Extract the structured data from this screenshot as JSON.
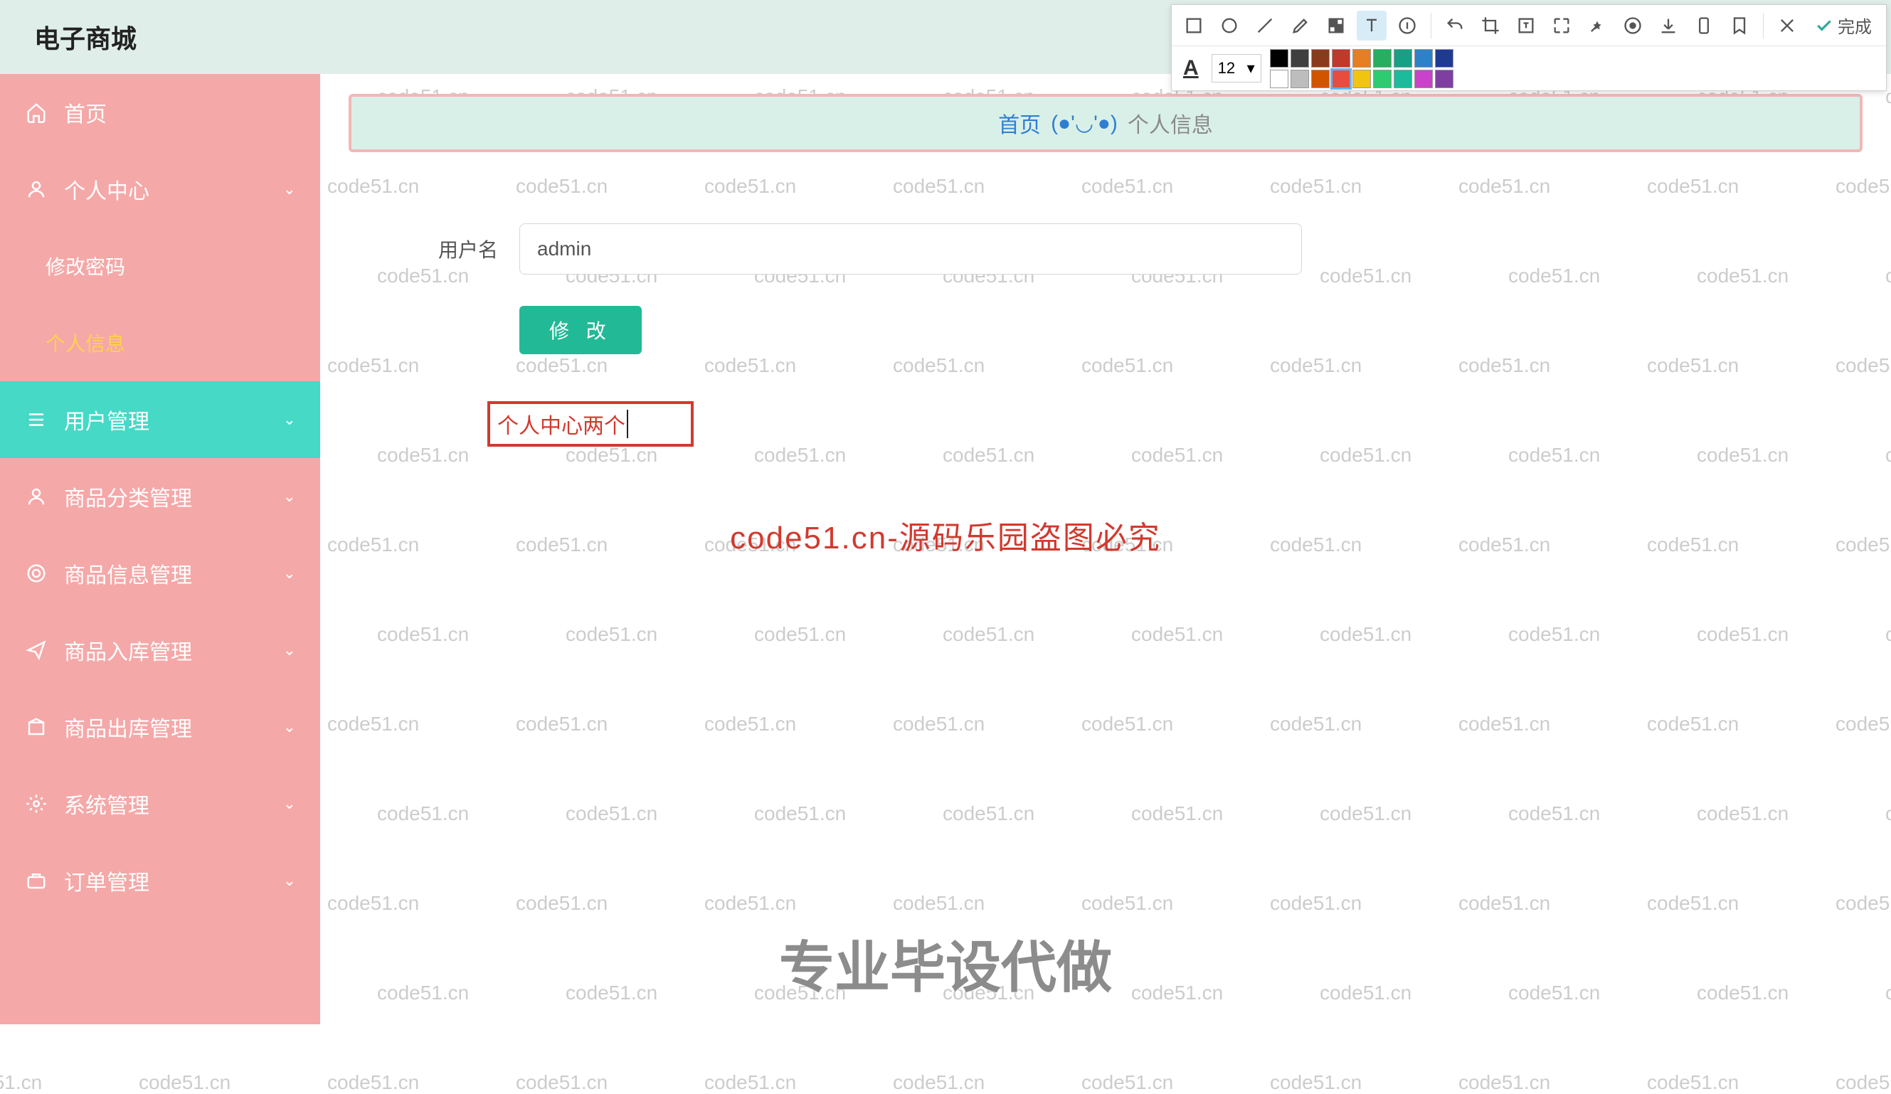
{
  "brand": "电子商城",
  "sidebar": {
    "items": [
      {
        "label": "首页",
        "icon": "home"
      },
      {
        "label": "个人中心",
        "icon": "user",
        "expandable": true
      },
      {
        "label": "修改密码",
        "sub": true
      },
      {
        "label": "个人信息",
        "sub": true,
        "activePage": true
      },
      {
        "label": "用户管理",
        "icon": "menu",
        "expandable": true,
        "highlight": true
      },
      {
        "label": "商品分类管理",
        "icon": "user",
        "expandable": true
      },
      {
        "label": "商品信息管理",
        "icon": "target",
        "expandable": true
      },
      {
        "label": "商品入库管理",
        "icon": "send",
        "expandable": true
      },
      {
        "label": "商品出库管理",
        "icon": "box",
        "expandable": true
      },
      {
        "label": "系统管理",
        "icon": "gear",
        "expandable": true
      },
      {
        "label": "订单管理",
        "icon": "case",
        "expandable": true
      }
    ]
  },
  "breadcrumb": {
    "home": "首页",
    "sep": "(●'◡'●)",
    "current": "个人信息"
  },
  "form": {
    "username_label": "用户名",
    "username_value": "admin",
    "submit": "修 改"
  },
  "annotation_text": "个人中心两个",
  "center_red": "code51.cn-源码乐园盗图必究",
  "bottom_gray": "专业毕设代做",
  "watermark_text": "code51.cn",
  "editor": {
    "done": "完成",
    "font_size": "12",
    "palette_row1": [
      "#000000",
      "#3f3f3f",
      "#8b3a1e",
      "#c0392b",
      "#e67e22",
      "#27ae60",
      "#16a085",
      "#2c82c9",
      "#1f3a93"
    ],
    "palette_row2": [
      "#ffffff",
      "#bdbdbd",
      "#d35400",
      "#e74c3c",
      "#f1c40f",
      "#2ecc71",
      "#1abc9c",
      "#c942c9",
      "#7f3fa0"
    ],
    "selected_swatch": "#e74c3c"
  }
}
